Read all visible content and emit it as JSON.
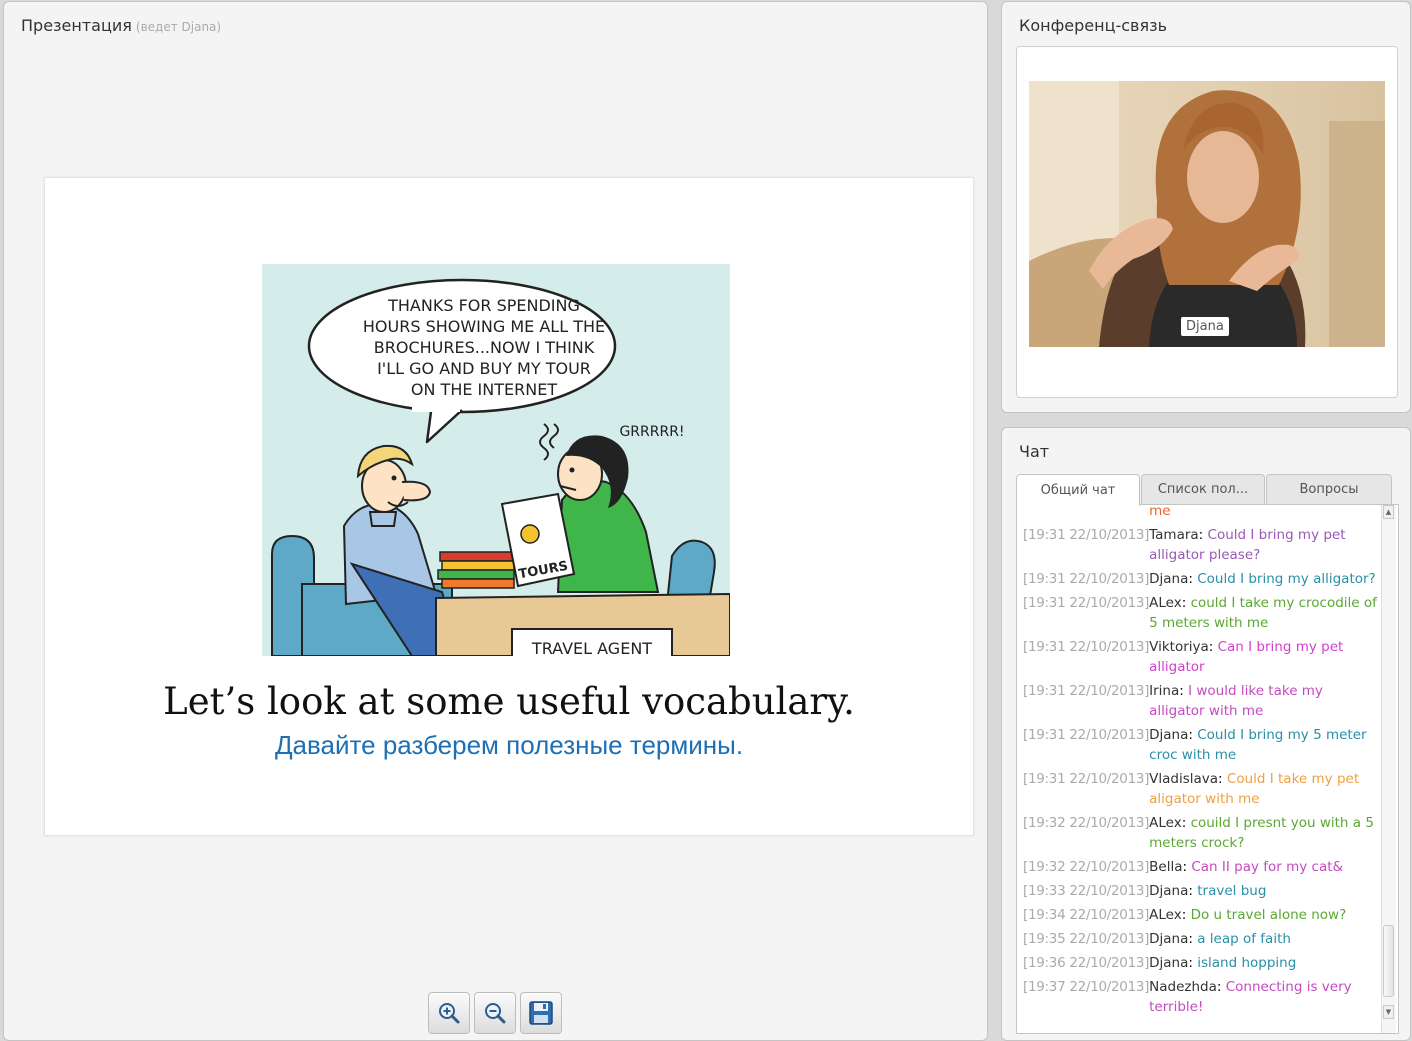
{
  "presentation": {
    "title": "Презентация",
    "presenter_note": "(ведет Djana)",
    "slide": {
      "speech_bubble": [
        "THANKS FOR SPENDING",
        "HOURS SHOWING ME ALL THE",
        "BROCHURES...NOW I THINK",
        "I'LL GO AND BUY MY TOUR",
        "ON THE INTERNET"
      ],
      "growl": "GRRRRR!",
      "brochure_label": "TOURS",
      "desk_sign": "TRAVEL AGENT",
      "caption_en": "Let’s look at some useful vocabulary.",
      "caption_ru": "Давайте разберем полезные термины."
    },
    "toolbar": [
      {
        "icon": "zoom-in-icon"
      },
      {
        "icon": "zoom-out-icon"
      },
      {
        "icon": "save-icon"
      }
    ]
  },
  "conference": {
    "title": "Конференц-связь",
    "participant_label": "Djana"
  },
  "chat": {
    "title": "Чат",
    "tabs": [
      {
        "label": "Общий чат",
        "active": true
      },
      {
        "label": "Список пол...",
        "active": false
      },
      {
        "label": "Вопросы",
        "active": false
      }
    ],
    "partial_top_text": "me",
    "partial_top_color": "#e8642d",
    "messages": [
      {
        "time": "[19:31 22/10/2013]",
        "name": "Tamara",
        "text": "Could I bring my pet alligator please?",
        "color": "#9b59b6"
      },
      {
        "time": "[19:31 22/10/2013]",
        "name": "Djana",
        "text": "Could I bring my alligator?",
        "color": "#2a8fa8"
      },
      {
        "time": "[19:31 22/10/2013]",
        "name": "ALex",
        "text": "could I take my crocodile of 5 meters with me",
        "color": "#5aa832"
      },
      {
        "time": "[19:31 22/10/2013]",
        "name": "Viktoriya",
        "text": "Can I bring my pet alligator",
        "color": "#d23fcf"
      },
      {
        "time": "[19:31 22/10/2013]",
        "name": "Irina",
        "text": "I would like take my alligator with me",
        "color": "#c64ac2"
      },
      {
        "time": "[19:31 22/10/2013]",
        "name": "Djana",
        "text": "Could I bring my 5 meter croc with me",
        "color": "#2a8fa8"
      },
      {
        "time": "[19:31 22/10/2013]",
        "name": "Vladislava",
        "text": "Could I take my pet aligator with me",
        "color": "#f0a040"
      },
      {
        "time": "[19:32 22/10/2013]",
        "name": "ALex",
        "text": "couild I presnt  you with a 5 meters crock?",
        "color": "#5aa832"
      },
      {
        "time": "[19:32 22/10/2013]",
        "name": "Bella",
        "text": "Can  II pay for  my  cat&",
        "color": "#c64ac2"
      },
      {
        "time": "[19:33 22/10/2013]",
        "name": "Djana",
        "text": "travel bug",
        "color": "#2a8fa8"
      },
      {
        "time": "[19:34 22/10/2013]",
        "name": "ALex",
        "text": "Do u travel alone now?",
        "color": "#5aa832"
      },
      {
        "time": "[19:35 22/10/2013]",
        "name": "Djana",
        "text": "a leap of faith",
        "color": "#2a8fa8"
      },
      {
        "time": "[19:36 22/10/2013]",
        "name": "Djana",
        "text": "island hopping",
        "color": "#2a8fa8"
      },
      {
        "time": "[19:37 22/10/2013]",
        "name": "Nadezhda",
        "text": "Connecting is very terrible!",
        "color": "#c64ac2"
      }
    ]
  }
}
